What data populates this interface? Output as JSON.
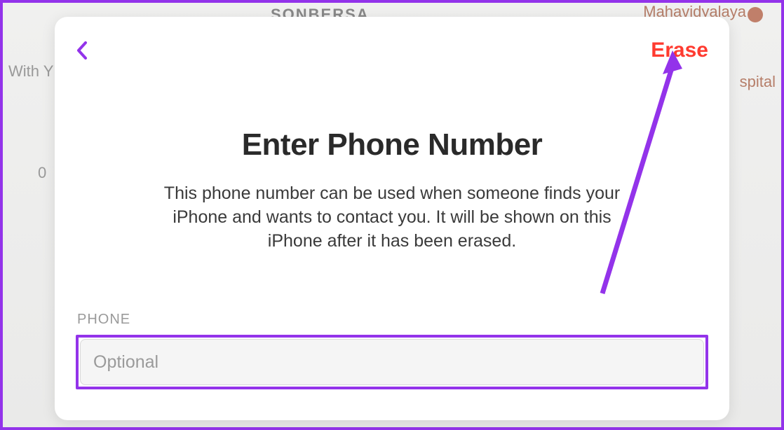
{
  "mapLabels": {
    "sonbersa": "SONBERSA",
    "mahavidyalaya": "Mahavidyalaya",
    "hospital": "spital",
    "withy": "With Y",
    "zero": "0"
  },
  "modal": {
    "eraseButton": "Erase",
    "title": "Enter Phone Number",
    "description": "This phone number can be used when someone finds your iPhone and wants to contact you. It will be shown on this iPhone after it has been erased.",
    "phoneLabel": "PHONE",
    "phonePlaceholder": "Optional",
    "phoneValue": ""
  }
}
